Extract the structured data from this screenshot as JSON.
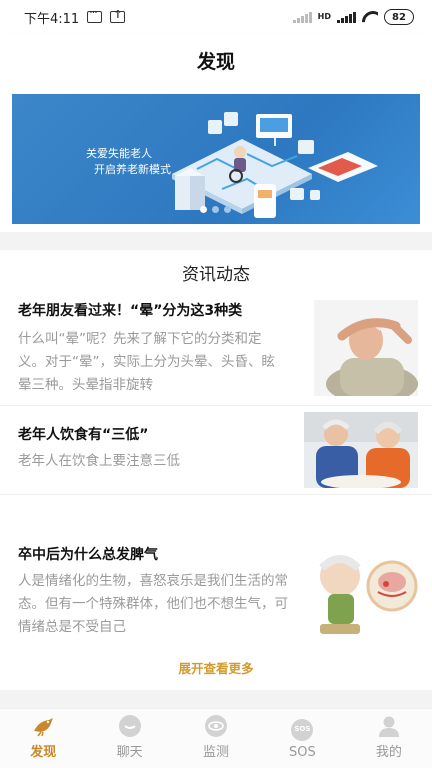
{
  "status_bar": {
    "time": "下午4:11",
    "battery": "82",
    "network": "HD"
  },
  "header": {
    "title": "发现"
  },
  "banner": {
    "line1": "关爱失能老人",
    "line2": "开启养老新模式",
    "slide_count": 3,
    "active_slide": 1
  },
  "news": {
    "section_title": "资讯动态",
    "items": [
      {
        "headline": "老年朋友看过来！“晕”分为这3种类",
        "summary": "什么叫“晕”呢？先来了解下它的分类和定义。对于“晕”，实际上分为头晕、头昏、眩晕三种。头晕指非旋转"
      },
      {
        "headline": "老年人饮食有“三低”",
        "summary": "老年人在饮食上要注意三低"
      },
      {
        "headline": "卒中后为什么总发脾气",
        "summary": "人是情绪化的生物，喜怒哀乐是我们生活的常态。但有一个特殊群体，他们也不想生气，可情绪总是不受自己"
      }
    ],
    "expand_label": "展开查看更多"
  },
  "bottom_nav": {
    "items": [
      {
        "label": "发现",
        "icon": "bird-icon",
        "active": true
      },
      {
        "label": "聊天",
        "icon": "chat-icon",
        "active": false
      },
      {
        "label": "监测",
        "icon": "eye-icon",
        "active": false
      },
      {
        "label": "SOS",
        "icon": "sos-icon",
        "active": false
      },
      {
        "label": "我的",
        "icon": "user-icon",
        "active": false
      }
    ]
  },
  "colors": {
    "accent": "#c8892a",
    "expand_link": "#d39a2f",
    "banner_bg": "#2d78c0",
    "inactive": "#999999"
  }
}
